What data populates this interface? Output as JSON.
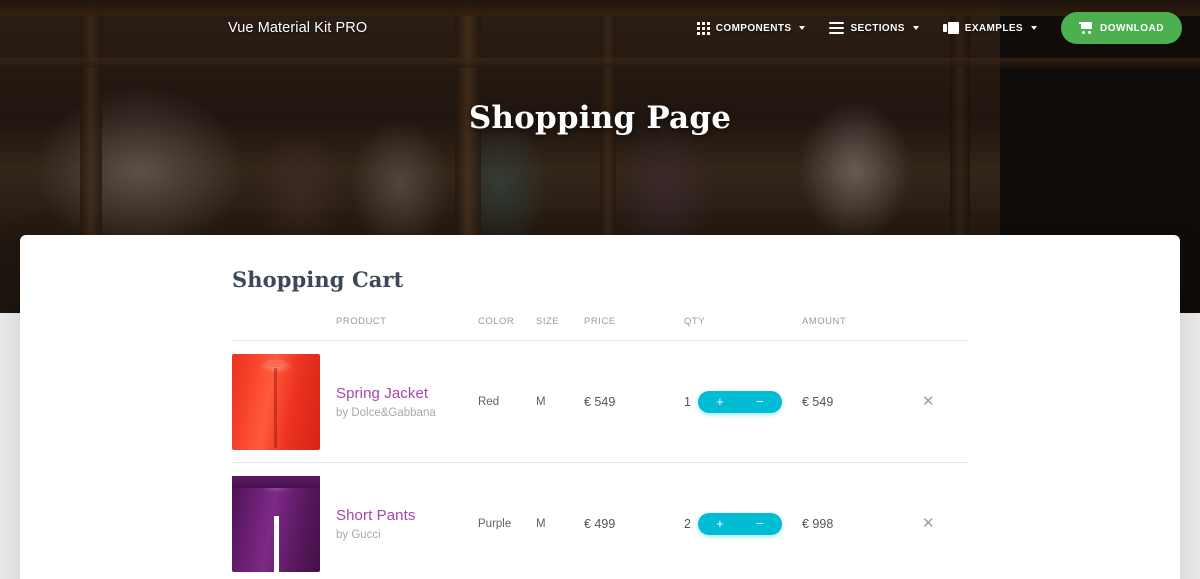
{
  "navbar": {
    "brand": "Vue Material Kit PRO",
    "items": [
      {
        "label": "COMPONENTS",
        "icon": "grid-icon",
        "has_caret": true
      },
      {
        "label": "SECTIONS",
        "icon": "lines-icon",
        "has_caret": true
      },
      {
        "label": "EXAMPLES",
        "icon": "image-icon",
        "has_caret": true
      }
    ],
    "download_label": "DOWNLOAD",
    "download_icon": "cart-icon",
    "download_color": "#4caf50"
  },
  "hero": {
    "title": "Shopping Page"
  },
  "cart": {
    "heading": "Shopping Cart",
    "columns": [
      "PRODUCT",
      "COLOR",
      "SIZE",
      "PRICE",
      "QTY",
      "AMOUNT"
    ],
    "accent_color": "#00bcd4",
    "link_color": "#a844b0",
    "rows": [
      {
        "name": "Spring Jacket",
        "by": "by Dolce&Gabbana",
        "image": "red-jacket-thumbnail",
        "color": "Red",
        "size": "M",
        "price": "€ 549",
        "qty": "1",
        "qty_plus": "+",
        "qty_minus": "−",
        "amount": "€ 549",
        "remove": "✕"
      },
      {
        "name": "Short Pants",
        "by": "by Gucci",
        "image": "purple-pants-thumbnail",
        "color": "Purple",
        "size": "M",
        "price": "€ 499",
        "qty": "2",
        "qty_plus": "+",
        "qty_minus": "−",
        "amount": "€ 998",
        "remove": "✕"
      }
    ]
  }
}
